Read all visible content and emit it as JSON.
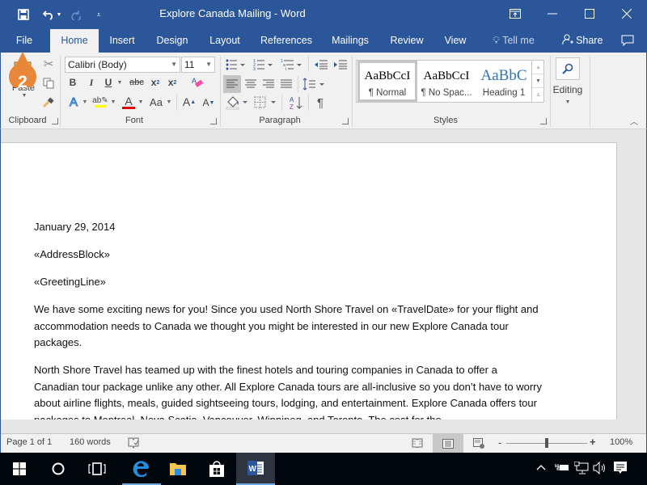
{
  "window": {
    "title": "Explore Canada Mailing  -  Word",
    "controls": {
      "ribbon_display": "ribbon-display-options",
      "minimize": "minimize",
      "maximize": "maximize",
      "close": "close"
    }
  },
  "quick_access": {
    "icons": [
      "save-icon",
      "undo-icon",
      "redo-icon",
      "customize-icon"
    ]
  },
  "tabs": [
    {
      "label": "File"
    },
    {
      "label": "Home",
      "active": true
    },
    {
      "label": "Insert"
    },
    {
      "label": "Design"
    },
    {
      "label": "Layout"
    },
    {
      "label": "References"
    },
    {
      "label": "Mailings"
    },
    {
      "label": "Review"
    },
    {
      "label": "View"
    }
  ],
  "tell_me": "Tell me",
  "share": "Share",
  "ribbon": {
    "clipboard": {
      "label": "Clipboard",
      "paste": "Paste"
    },
    "font": {
      "label": "Font",
      "font_name": "Calibri (Body)",
      "font_size": "11",
      "bold": "B",
      "italic": "I",
      "underline": "U",
      "strike": "abc",
      "subscript": "x",
      "superscript": "x",
      "change_case": "Aa",
      "highlight_color": "#ffff00",
      "font_color": "#e00000"
    },
    "paragraph": {
      "label": "Paragraph"
    },
    "styles": {
      "label": "Styles",
      "items": [
        {
          "preview": "AaBbCcI",
          "name": "¶ Normal",
          "selected": true
        },
        {
          "preview": "AaBbCcI",
          "name": "¶ No Spac..."
        },
        {
          "preview": "AaBbC",
          "name": "Heading 1"
        }
      ]
    },
    "editing": {
      "label": "Editing"
    }
  },
  "badge": {
    "number": "2",
    "color": "#e8873a"
  },
  "document": {
    "paragraphs": [
      "January 29, 2014",
      "«AddressBlock»",
      "«GreetingLine»",
      "We have some exciting news for you! Since you used North Shore Travel on «TravelDate» for your flight and accommodation needs to Canada we thought you might be interested in our new Explore Canada tour packages.",
      "North Shore Travel has teamed up with the finest hotels and touring companies in Canada to offer a Canadian tour package unlike any other. All Explore Canada tours are all-inclusive so you don’t have to worry about airline flights, meals, guided sightseeing tours, lodging, and entertainment. Explore Canada offers tour packages to Montreal, Nova Scotia, Vancouver, Winnipeg, and Toronto. The cost for the"
    ]
  },
  "status": {
    "page": "Page 1 of 1",
    "words": "160 words",
    "zoom": "100%",
    "zoom_level_percent": 100
  },
  "taskbar": {
    "apps": [
      "start",
      "cortana",
      "task-view",
      "edge",
      "file-explorer",
      "store",
      "word"
    ],
    "active_app": "word"
  }
}
